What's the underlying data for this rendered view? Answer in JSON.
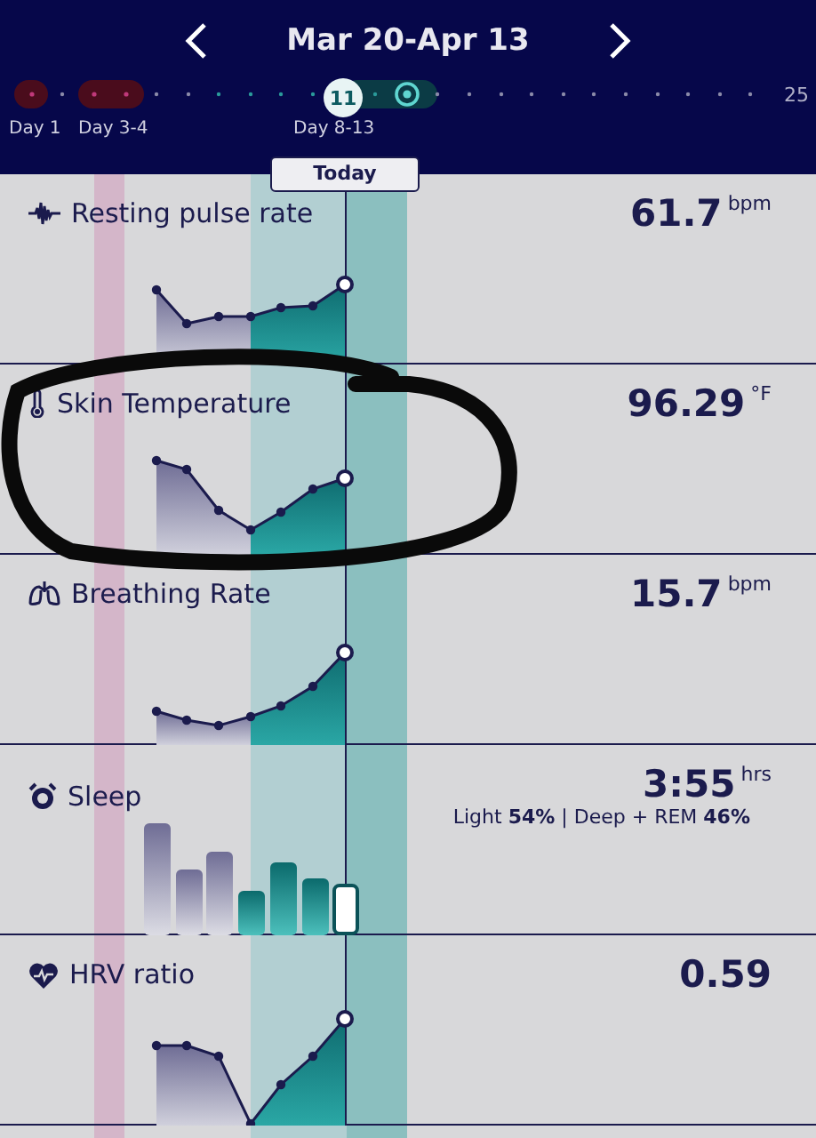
{
  "header": {
    "title": "Mar 20-Apr 13"
  },
  "timeline": {
    "phases": [
      {
        "label": "Day 1"
      },
      {
        "label": "Day 3-4"
      },
      {
        "label": "Day 8-13"
      }
    ],
    "today_day": "11",
    "end_day": "25",
    "today_label": "Today"
  },
  "metrics": [
    {
      "kind": "line",
      "name": "Resting pulse rate",
      "value": "61.7",
      "unit": "bpm"
    },
    {
      "kind": "line",
      "name": "Skin Temperature",
      "value": "96.29",
      "unit": "°F"
    },
    {
      "kind": "line",
      "name": "Breathing Rate",
      "value": "15.7",
      "unit": "bpm"
    },
    {
      "kind": "bars",
      "name": "Sleep",
      "value": "3:55",
      "unit": "hrs",
      "detail": "Light **54%** | Deep + REM **46%**"
    },
    {
      "kind": "line",
      "name": "HRV ratio",
      "value": "0.59"
    }
  ]
}
